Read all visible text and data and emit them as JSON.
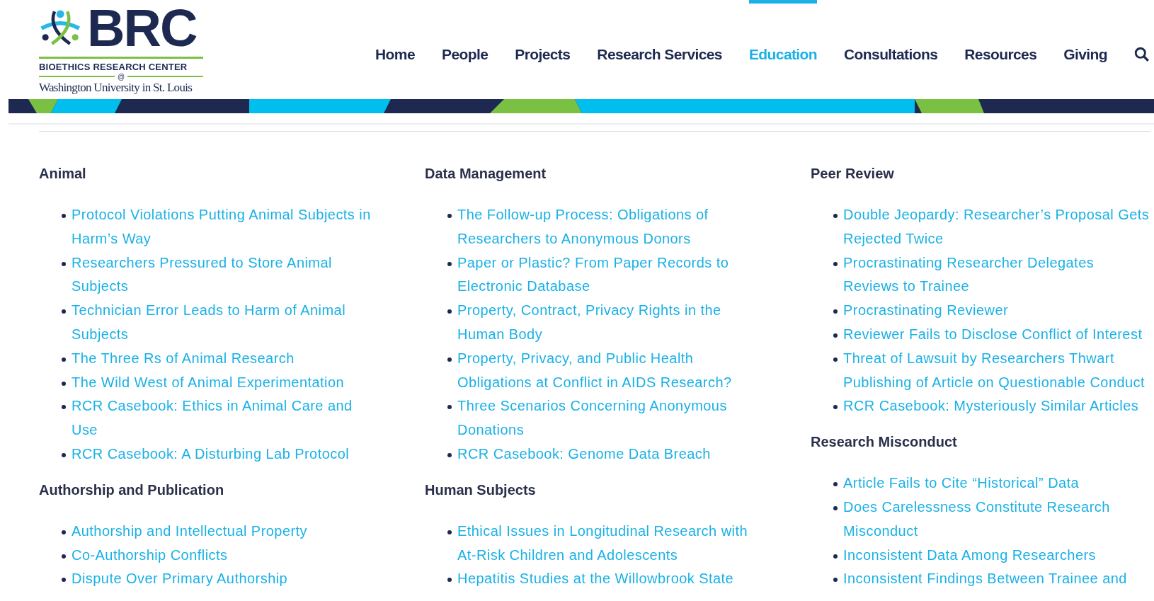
{
  "logo": {
    "initials": "BRC",
    "name": "BIOETHICS RESEARCH CENTER",
    "at": "@",
    "university": "Washington University in St. Louis"
  },
  "nav": [
    {
      "label": "Home",
      "selected": false
    },
    {
      "label": "People",
      "selected": false
    },
    {
      "label": "Projects",
      "selected": false
    },
    {
      "label": "Research Services",
      "selected": false
    },
    {
      "label": "Education",
      "selected": true
    },
    {
      "label": "Consultations",
      "selected": false
    },
    {
      "label": "Resources",
      "selected": false
    },
    {
      "label": "Giving",
      "selected": false
    }
  ],
  "columns": [
    [
      {
        "heading": "Animal",
        "items": [
          "Protocol Violations Putting Animal Subjects in Harm’s Way",
          "Researchers Pressured to Store Animal Subjects",
          "Technician Error Leads to Harm of Animal Subjects",
          "The Three Rs of Animal Research",
          "The Wild West of Animal Experimentation",
          "RCR Casebook: Ethics in Animal Care and Use",
          "RCR Casebook: A Disturbing Lab Protocol"
        ]
      },
      {
        "heading": "Authorship and Publication",
        "items": [
          "Authorship and Intellectual Property",
          "Co-Authorship Conflicts",
          "Dispute Over Primary Authorship"
        ]
      }
    ],
    [
      {
        "heading": "Data Management",
        "items": [
          "The Follow-up Process: Obligations of Researchers to Anonymous Donors",
          "Paper or Plastic? From Paper Records to Electronic Database",
          "Property, Contract, Privacy Rights in the Human Body",
          "Property, Privacy, and Public Health Obligations at Conflict in AIDS Research?",
          "Three Scenarios Concerning Anonymous Donations",
          "RCR Casebook: Genome Data Breach"
        ]
      },
      {
        "heading": "Human Subjects",
        "items": [
          "Ethical Issues in Longitudinal Research with At-Risk Children and Adolescents",
          "Hepatitis Studies at the Willowbrook State"
        ]
      }
    ],
    [
      {
        "heading": "Peer Review",
        "items": [
          "Double Jeopardy: Researcher’s Proposal Gets Rejected Twice",
          "Procrastinating Researcher Delegates Reviews to Trainee",
          "Procrastinating Reviewer",
          "Reviewer Fails to Disclose Conflict of Interest",
          "Threat of Lawsuit by Researchers Thwart Publishing of Article on Questionable Conduct",
          "RCR Casebook: Mysteriously Similar Articles"
        ]
      },
      {
        "heading": "Research Misconduct",
        "items": [
          "Article Fails to Cite “Historical” Data",
          "Does Carelessness Constitute Research Misconduct",
          "Inconsistent Data Among Researchers",
          "Inconsistent Findings Between Trainee and"
        ]
      }
    ]
  ]
}
